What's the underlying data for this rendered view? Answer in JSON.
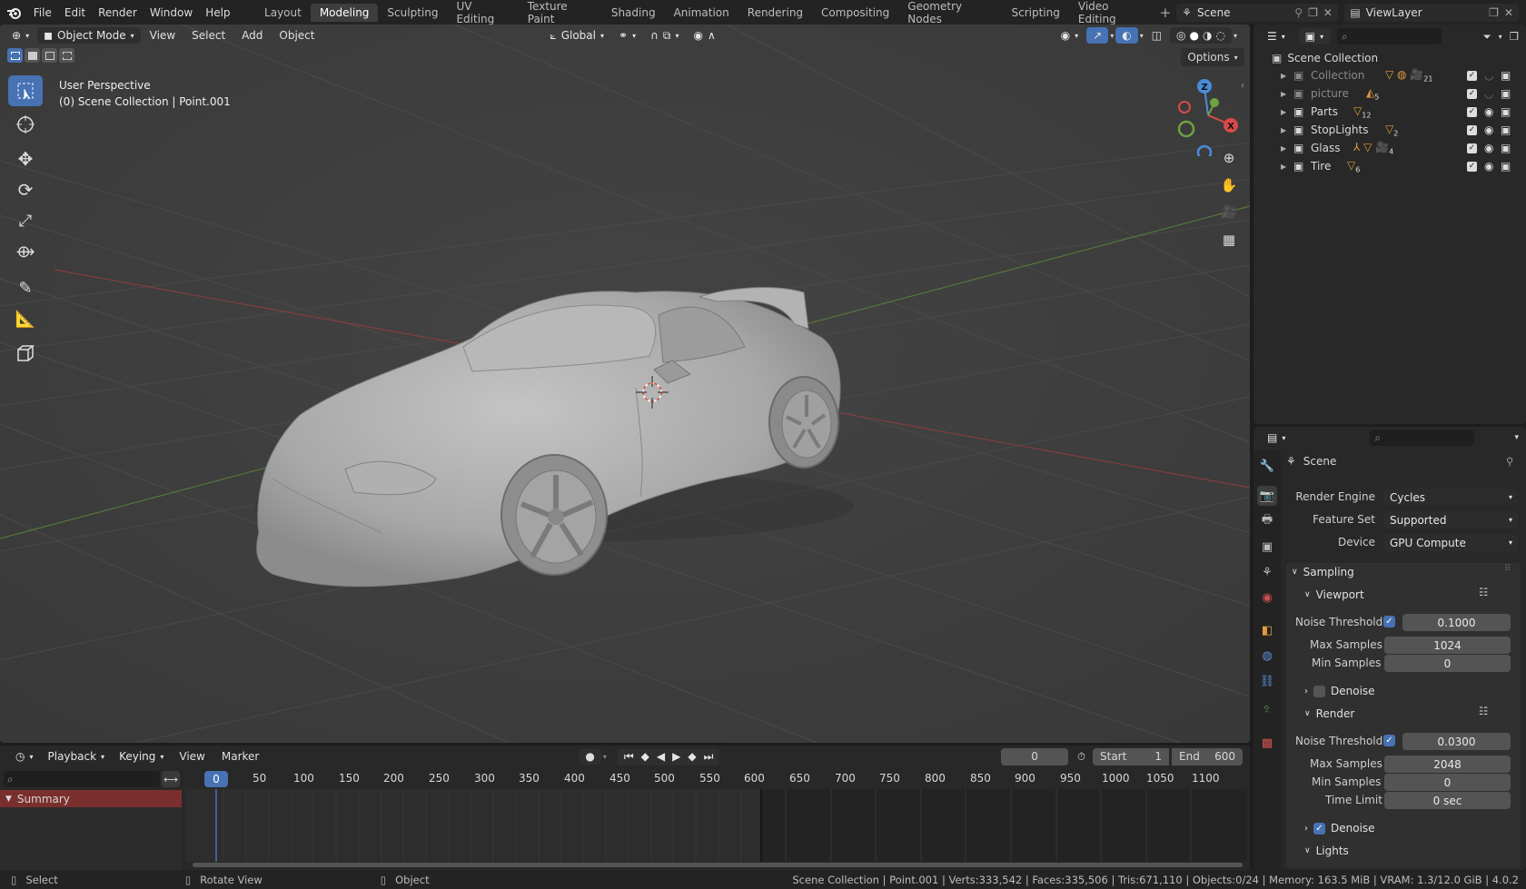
{
  "topbar": {
    "menus": [
      "File",
      "Edit",
      "Render",
      "Window",
      "Help"
    ],
    "workspaces": [
      "Layout",
      "Modeling",
      "Sculpting",
      "UV Editing",
      "Texture Paint",
      "Shading",
      "Animation",
      "Rendering",
      "Compositing",
      "Geometry Nodes",
      "Scripting",
      "Video Editing"
    ],
    "active_workspace": "Modeling",
    "scene": "Scene",
    "view_layer": "ViewLayer"
  },
  "viewport": {
    "mode": "Object Mode",
    "menus": [
      "View",
      "Select",
      "Add",
      "Object"
    ],
    "transform_orientation": "Global",
    "options_label": "Options",
    "overlay_line1": "User Perspective",
    "overlay_line2": "(0) Scene Collection | Point.001",
    "gizmo": {
      "z": "Z",
      "x": "X"
    }
  },
  "outliner": {
    "root": "Scene Collection",
    "items": [
      {
        "name": "Collection",
        "badge": "21",
        "dim": true
      },
      {
        "name": "picture",
        "badge": "5",
        "dim": true
      },
      {
        "name": "Parts",
        "badge": "12",
        "dim": false
      },
      {
        "name": "StopLights",
        "badge": "2",
        "dim": false
      },
      {
        "name": "Glass",
        "badge": "4",
        "dim": false
      },
      {
        "name": "Tire",
        "badge": "6",
        "dim": false
      }
    ]
  },
  "properties": {
    "context": "Scene",
    "render_engine_label": "Render Engine",
    "render_engine": "Cycles",
    "feature_set_label": "Feature Set",
    "feature_set": "Supported",
    "device_label": "Device",
    "device": "GPU Compute",
    "sampling": "Sampling",
    "viewport_panel": "Viewport",
    "render_panel": "Render",
    "noise_threshold_label": "Noise Threshold",
    "max_samples_label": "Max Samples",
    "min_samples_label": "Min Samples",
    "time_limit_label": "Time Limit",
    "denoise_label": "Denoise",
    "lights_label": "Lights",
    "vp_noise_threshold": "0.1000",
    "vp_max_samples": "1024",
    "vp_min_samples": "0",
    "r_noise_threshold": "0.0300",
    "r_max_samples": "2048",
    "r_min_samples": "0",
    "r_time_limit": "0 sec"
  },
  "timeline": {
    "menus": [
      "Playback",
      "Keying",
      "View",
      "Marker"
    ],
    "current_frame": "0",
    "start_label": "Start",
    "start": "1",
    "end_label": "End",
    "end": "600",
    "ruler": [
      "0",
      "50",
      "100",
      "150",
      "200",
      "250",
      "300",
      "350",
      "400",
      "450",
      "500",
      "550",
      "600",
      "650",
      "700",
      "750",
      "800",
      "850",
      "900",
      "950",
      "1000",
      "1050",
      "1100"
    ],
    "summary": "Summary"
  },
  "statusbar": {
    "select": "Select",
    "rotate": "Rotate View",
    "object": "Object",
    "stats": "Scene Collection | Point.001 | Verts:333,542 | Faces:335,506 | Tris:671,110 | Objects:0/24 | Memory: 163.5 MiB | VRAM: 1.3/12.0 GiB | 4.0.2"
  },
  "colors": {
    "accent": "#4772b3",
    "background": "#3d3d3d",
    "panel": "#282828",
    "orange": "#e39a3c"
  }
}
